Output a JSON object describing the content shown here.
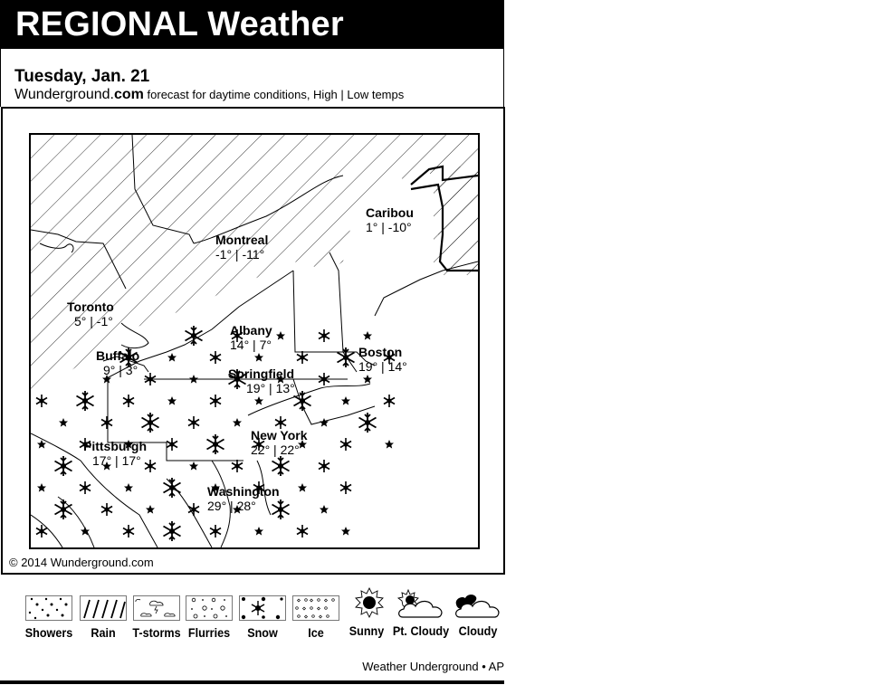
{
  "header": {
    "title": "REGIONAL Weather",
    "date": "Tuesday, Jan. 21",
    "brand_prefix": "Wunderground.",
    "brand_suffix": "com",
    "subtitle": " forecast for daytime conditions, High | Low temps"
  },
  "map": {
    "region": "Northeastern United States & Southeastern Canada",
    "cities": [
      {
        "name": "Caribou",
        "high": "1°",
        "low": "-10°",
        "temps": "1° | -10°",
        "condition": "none"
      },
      {
        "name": "Montreal",
        "high": "-1°",
        "low": "-11°",
        "temps": "-1° | -11°",
        "condition": "none"
      },
      {
        "name": "Toronto",
        "high": "5°",
        "low": "-1°",
        "temps": "5° | -1°",
        "condition": "none"
      },
      {
        "name": "Albany",
        "high": "14°",
        "low": "7°",
        "temps": "14° | 7°",
        "condition": "none"
      },
      {
        "name": "Buffalo",
        "high": "9°",
        "low": "3°",
        "temps": "9° | 3°",
        "condition": "snow"
      },
      {
        "name": "Boston",
        "high": "19°",
        "low": "14°",
        "temps": "19° | 14°",
        "condition": "snow"
      },
      {
        "name": "Springfield",
        "high": "19°",
        "low": "13°",
        "temps": "19° | 13°",
        "condition": "snow"
      },
      {
        "name": "New York",
        "high": "22°",
        "low": "22°",
        "temps": "22° | 22°",
        "condition": "snow"
      },
      {
        "name": "Pittsburgh",
        "high": "17°",
        "low": "17°",
        "temps": "17° | 17°",
        "condition": "snow"
      },
      {
        "name": "Washington",
        "high": "29°",
        "low": "28°",
        "temps": "29° | 28°",
        "condition": "snow"
      }
    ],
    "copyright": "© 2014 Wunderground.com"
  },
  "legend": {
    "items": [
      {
        "label": "Showers",
        "icon": "showers-pattern-icon"
      },
      {
        "label": "Rain",
        "icon": "rain-pattern-icon"
      },
      {
        "label": "T-storms",
        "icon": "tstorms-pattern-icon"
      },
      {
        "label": "Flurries",
        "icon": "flurries-pattern-icon"
      },
      {
        "label": "Snow",
        "icon": "snow-pattern-icon"
      },
      {
        "label": "Ice",
        "icon": "ice-pattern-icon"
      },
      {
        "label": "Sunny",
        "icon": "sun-icon"
      },
      {
        "label": "Pt. Cloudy",
        "icon": "partly-cloudy-icon"
      },
      {
        "label": "Cloudy",
        "icon": "cloudy-icon"
      }
    ]
  },
  "footer": {
    "credit": "Weather Underground • AP"
  }
}
